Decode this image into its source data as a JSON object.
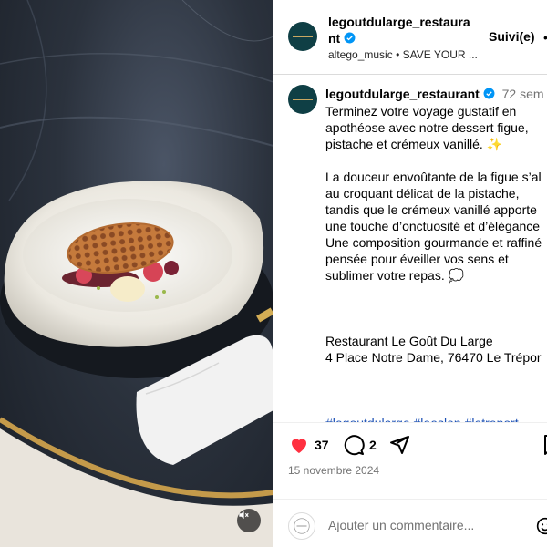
{
  "post": {
    "username": "legoutdularge_restaurant",
    "verified": true,
    "follow_label": "Suivi(e)",
    "more_label": "•",
    "audio_user": "altego_music",
    "audio_sep": "•",
    "audio_title": "SAVE YOUR ..."
  },
  "caption": {
    "username": "legoutdularge_restaurant",
    "time": "72 sem",
    "lines": [
      "Terminez votre voyage gustatif en",
      "apothéose avec notre dessert figue,",
      "pistache et crémeux vanillé. ✨",
      "",
      "La douceur envoûtante de la figue s’al",
      "au croquant délicat de la pistache,",
      "tandis que le crémeux vanillé apporte",
      "une touche d’onctuosité et d’élégance",
      "Une composition gourmande et raffiné",
      "pensée pour éveiller vos sens et",
      "sublimer votre repas. 💭",
      "",
      "_____",
      "",
      "Restaurant Le Goût Du Large",
      "4 Place Notre Dame, 76470 Le Trépor",
      "",
      "_______",
      ""
    ],
    "hashtags": "#legoutdularge #leeslen #letreport"
  },
  "actions": {
    "likes": "37",
    "comments": "2"
  },
  "date": "15 novembre 2024",
  "comment_box": {
    "placeholder": "Ajouter un commentaire..."
  },
  "colors": {
    "like_red": "#ff3040",
    "verified_blue": "#0095f6",
    "brand_teal": "#0f3f45",
    "hashtag_blue": "#1a4fb4"
  },
  "icons": [
    "verified-badge-icon",
    "heart-icon",
    "comment-icon",
    "share-icon",
    "bookmark-icon",
    "emoji-icon",
    "mute-icon"
  ]
}
